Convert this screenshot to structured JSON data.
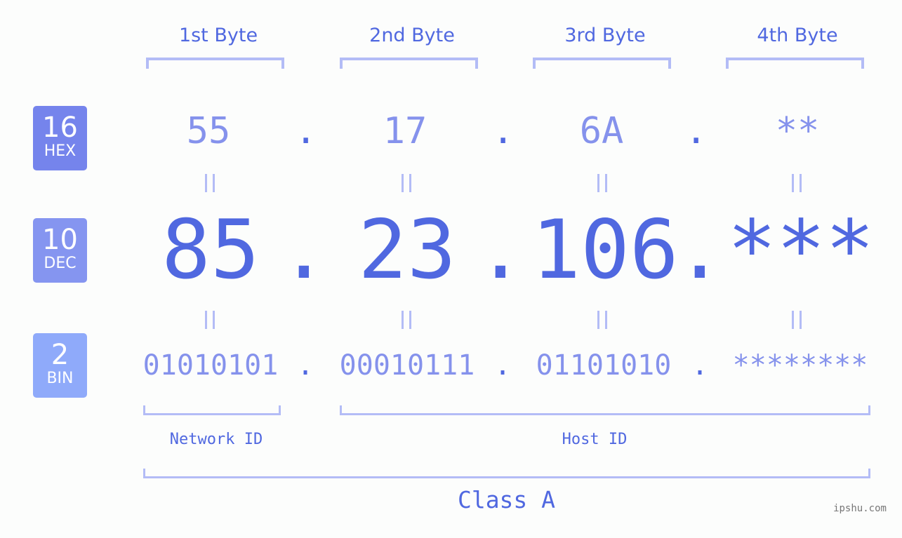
{
  "colors": {
    "accent": "#5068e0",
    "light_value": "#8592ec",
    "bracket": "#b3bcf6",
    "hex_box": "#7584ec",
    "dec_box": "#8595f0",
    "bin_box": "#8faafa",
    "background": "#fcfdfc"
  },
  "bases": [
    {
      "number": "16",
      "label": "HEX"
    },
    {
      "number": "10",
      "label": "DEC"
    },
    {
      "number": "2",
      "label": "BIN"
    }
  ],
  "byte_headers": [
    "1st Byte",
    "2nd Byte",
    "3rd Byte",
    "4th Byte"
  ],
  "separator": ".",
  "equals_sign": "=",
  "hex": [
    "55",
    "17",
    "6A",
    "**"
  ],
  "dec": [
    "85",
    "23",
    "106",
    "***"
  ],
  "bin": [
    "01010101",
    "00010111",
    "01101010",
    "********"
  ],
  "parts": {
    "network": "Network ID",
    "host": "Host ID"
  },
  "class_label": "Class A",
  "watermark": "ipshu.com"
}
